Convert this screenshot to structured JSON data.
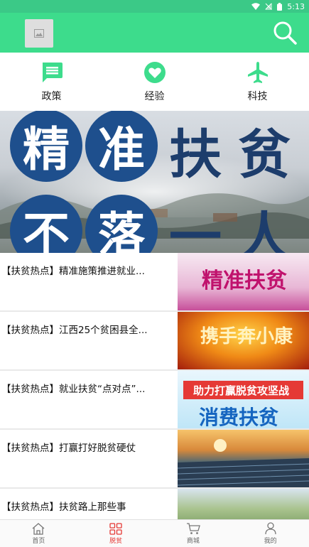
{
  "status_bar": {
    "time": "5:13"
  },
  "colors": {
    "accent": "#3ddc8c",
    "active_tab": "#e53935"
  },
  "categories": [
    {
      "label": "政策",
      "icon": "message-icon"
    },
    {
      "label": "经验",
      "icon": "heart-icon"
    },
    {
      "label": "科技",
      "icon": "airplane-icon"
    }
  ],
  "banner": {
    "line1": [
      "精",
      "准",
      "扶",
      "贫"
    ],
    "line2": [
      "不",
      "落",
      "一",
      "人"
    ]
  },
  "news": [
    {
      "title": "【扶贫热点】精准施策推进就业...",
      "thumb_text": "精准扶贫"
    },
    {
      "title": "【扶贫热点】江西25个贫困县全...",
      "thumb_text": "携手奔小康"
    },
    {
      "title": "【扶贫热点】就业扶贫“点对点”...",
      "thumb_text": "助力打赢脱贫攻坚战",
      "thumb_text2": "消费扶贫"
    },
    {
      "title": "【扶贫热点】打赢打好脱贫硬仗",
      "thumb_text": ""
    },
    {
      "title": "【扶贫热点】扶贫路上那些事",
      "thumb_text": ""
    }
  ],
  "bottom_nav": [
    {
      "label": "首页",
      "icon": "home-icon",
      "active": false
    },
    {
      "label": "脱贫",
      "icon": "grid-icon",
      "active": true
    },
    {
      "label": "商城",
      "icon": "cart-icon",
      "active": false
    },
    {
      "label": "我的",
      "icon": "person-icon",
      "active": false
    }
  ]
}
